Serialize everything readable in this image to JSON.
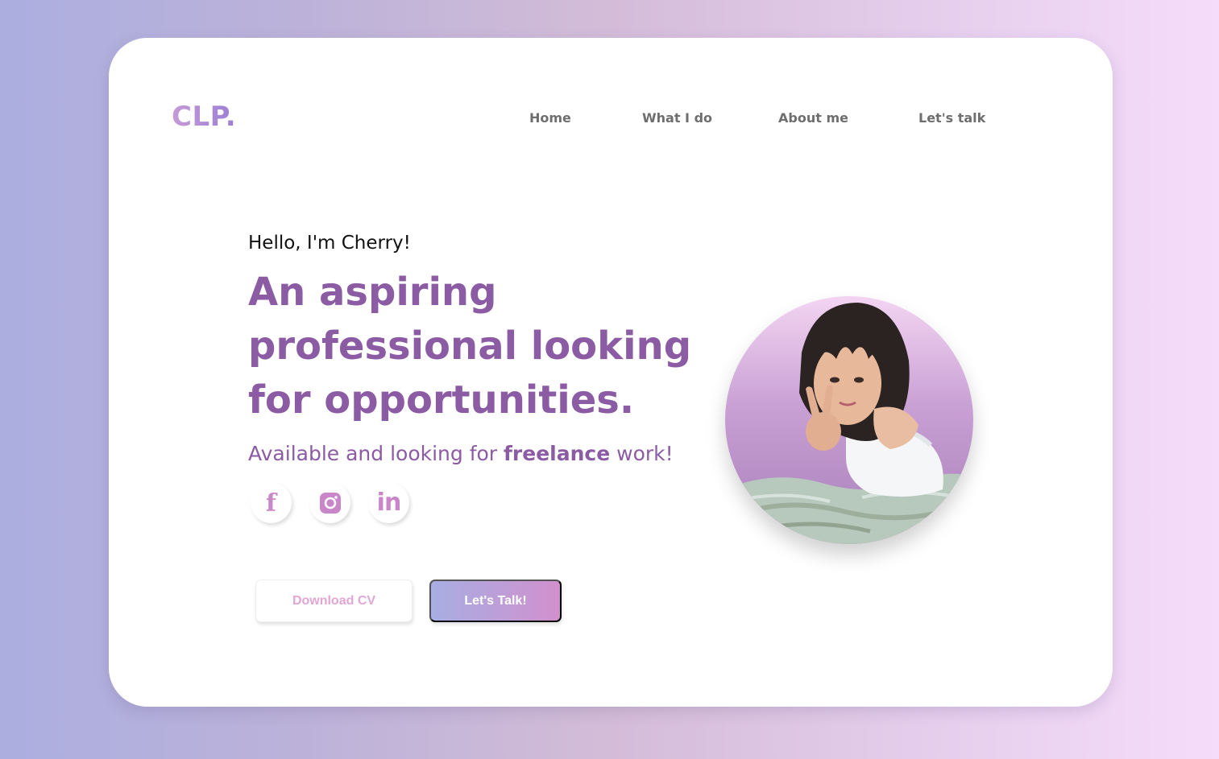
{
  "brand": {
    "logo_text": "CLP."
  },
  "nav": {
    "items": [
      "Home",
      "What I do",
      "About me",
      "Let's talk"
    ]
  },
  "hero": {
    "greeting": "Hello, I'm Cherry!",
    "headline": "An aspiring professional looking for opportunities.",
    "tagline_prefix": "Available and looking for ",
    "tagline_emphasis": "freelance",
    "tagline_suffix": " work!"
  },
  "socials": [
    {
      "icon": "facebook-icon"
    },
    {
      "icon": "instagram-icon"
    },
    {
      "icon": "linkedin-icon"
    }
  ],
  "buttons": {
    "download_cv": "Download CV",
    "lets_talk": "Let's Talk!"
  },
  "colors": {
    "accent": "#8b5ba3",
    "icon_pink": "#c986c9",
    "button_gradient_start": "#a7aee3",
    "button_gradient_end": "#d190cd"
  }
}
